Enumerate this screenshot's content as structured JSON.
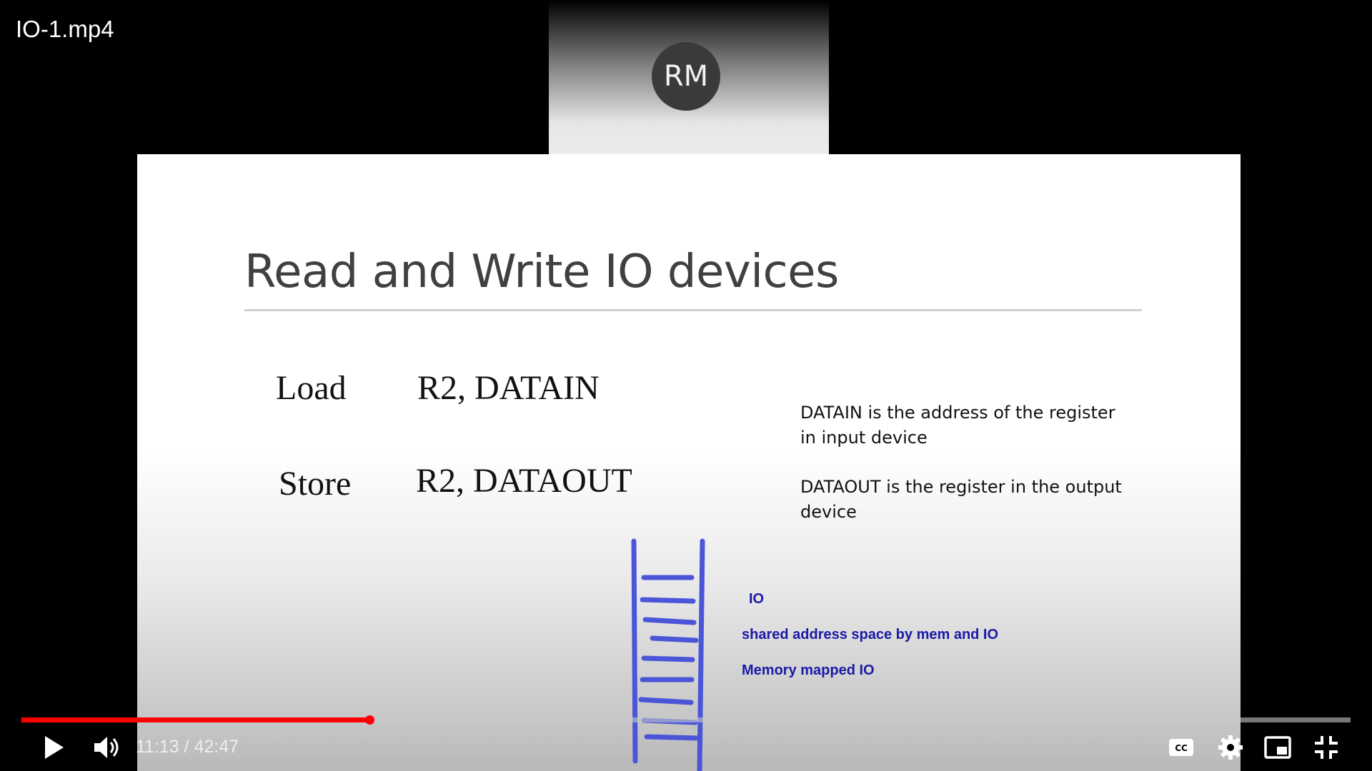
{
  "player": {
    "video_title": "IO-1.mp4",
    "current_time": "11:13",
    "duration": "42:47",
    "time_separator": " / ",
    "progress_fraction": 0.262
  },
  "participant": {
    "initials": "RM"
  },
  "slide": {
    "title": "Read and Write IO devices",
    "instructions": [
      {
        "op": "Load",
        "args": "R2, DATAIN"
      },
      {
        "op": "Store",
        "args": "R2, DATAOUT"
      }
    ],
    "notes": [
      [
        "DATAIN is the address of the register",
        "in input device"
      ],
      [
        "DATAOUT is the register in the output",
        "device"
      ]
    ],
    "annotations": [
      "IO",
      "shared address space by mem and IO",
      "Memory mapped IO"
    ]
  },
  "controls": {
    "play": "play-icon",
    "volume": "volume-icon",
    "captions": "captions-icon",
    "settings": "gear-icon",
    "miniplayer": "miniplayer-icon",
    "exit_fullscreen": "exit-fullscreen-icon"
  },
  "colors": {
    "progress": "#ff0000",
    "ink": "#1a1aa8",
    "ladder": "#4a55d8"
  }
}
